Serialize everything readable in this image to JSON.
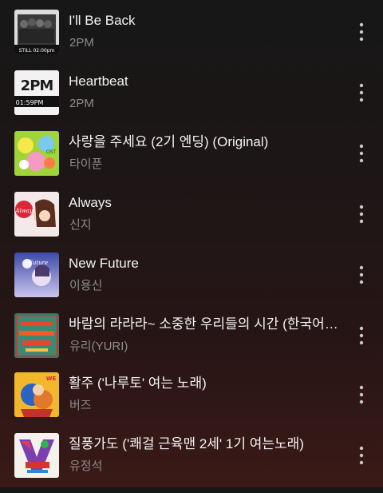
{
  "tracks": [
    {
      "title": "I'll Be Back",
      "artist": "2PM",
      "cover_text": "STILL 02:00pm",
      "icon": "more-icon"
    },
    {
      "title": "Heartbeat",
      "artist": "2PM",
      "cover_text": "01:59PM",
      "icon": "more-icon"
    },
    {
      "title": "사랑을 주세요 (2기 엔딩) (Original)",
      "artist": "타이푼",
      "cover_text": "OST",
      "icon": "more-icon"
    },
    {
      "title": "Always",
      "artist": "신지",
      "cover_text": "Always",
      "icon": "more-icon"
    },
    {
      "title": "New Future",
      "artist": "이용신",
      "cover_text": "Future",
      "icon": "more-icon"
    },
    {
      "title": "바람의 라라라~ 소중한 우리들의 시간 (한국어…",
      "artist": "유리(YURI)",
      "cover_text": "",
      "icon": "more-icon"
    },
    {
      "title": "활주 ('나루토' 여는 노래)",
      "artist": "버즈",
      "cover_text": "WE",
      "icon": "more-icon"
    },
    {
      "title": "질풍가도 ('쾌걸 근육맨 2세' 1기 여는노래)",
      "artist": "유정석",
      "cover_text": "",
      "icon": "more-icon"
    }
  ],
  "colors": {
    "background_top": "#171717",
    "background_bottom": "#3a1a16",
    "title": "#f4f4f4",
    "artist": "#8c8c8c",
    "more_icon": "#c8c8c8"
  }
}
